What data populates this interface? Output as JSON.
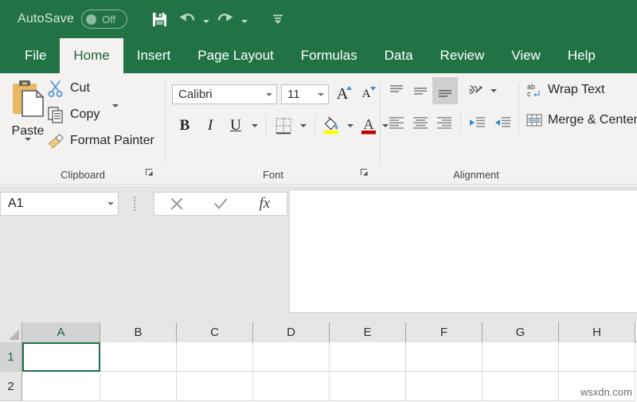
{
  "titlebar": {
    "autosave_label": "AutoSave",
    "autosave_state": "Off",
    "save_icon": "save-floppy-icon",
    "undo_icon": "undo-arrow-icon",
    "redo_icon": "redo-arrow-icon",
    "customize_icon": "customize-quick-access-toolbar-icon"
  },
  "tabs": [
    {
      "label": "File",
      "active": false
    },
    {
      "label": "Home",
      "active": true
    },
    {
      "label": "Insert",
      "active": false
    },
    {
      "label": "Page Layout",
      "active": false
    },
    {
      "label": "Formulas",
      "active": false
    },
    {
      "label": "Data",
      "active": false
    },
    {
      "label": "Review",
      "active": false
    },
    {
      "label": "View",
      "active": false
    },
    {
      "label": "Help",
      "active": false
    }
  ],
  "ribbon": {
    "clipboard": {
      "group_label": "Clipboard",
      "paste_label": "Paste",
      "cut_label": "Cut",
      "copy_label": "Copy",
      "format_painter_label": "Format Painter"
    },
    "font": {
      "group_label": "Font",
      "font_family_value": "Calibri",
      "font_size_value": "11",
      "grow_label": "A",
      "shrink_label": "A",
      "bold_label": "B",
      "italic_label": "I",
      "underline_label": "U"
    },
    "alignment": {
      "group_label": "Alignment",
      "wrap_text_label": "Wrap Text",
      "merge_center_label": "Merge & Center"
    }
  },
  "formula_bar": {
    "name_box_value": "A1",
    "cancel_icon": "cancel-x-icon",
    "enter_icon": "enter-check-icon",
    "function_icon": "insert-function-fx-icon",
    "input_value": "",
    "input_placeholder": ""
  },
  "grid": {
    "columns": [
      {
        "label": "A",
        "width": 98,
        "active": true
      },
      {
        "label": "B",
        "width": 96,
        "active": false
      },
      {
        "label": "C",
        "width": 96,
        "active": false
      },
      {
        "label": "D",
        "width": 96,
        "active": false
      },
      {
        "label": "E",
        "width": 96,
        "active": false
      },
      {
        "label": "F",
        "width": 96,
        "active": false
      },
      {
        "label": "G",
        "width": 96,
        "active": false
      },
      {
        "label": "H",
        "width": 96,
        "active": false
      }
    ],
    "rows": [
      {
        "label": "1",
        "active": true
      },
      {
        "label": "2",
        "active": false
      }
    ],
    "selected_cell": "A1",
    "cell_values": [
      [
        "",
        "",
        "",
        "",
        "",
        "",
        "",
        ""
      ],
      [
        "",
        "",
        "",
        "",
        "",
        "",
        "",
        ""
      ]
    ]
  },
  "watermark": {
    "text": "wsxdn.com"
  },
  "colors": {
    "excel_green": "#217346",
    "ribbon_bg": "#f3f2f1",
    "strip_bg": "#e6e6e6",
    "selection_green": "#217346",
    "paste_clipboard_orange": "#e8b864",
    "cut_scissors_blue": "#5b9bd5",
    "fill_highlight_yellow": "#ffff00",
    "font_color_red": "#c00000"
  }
}
